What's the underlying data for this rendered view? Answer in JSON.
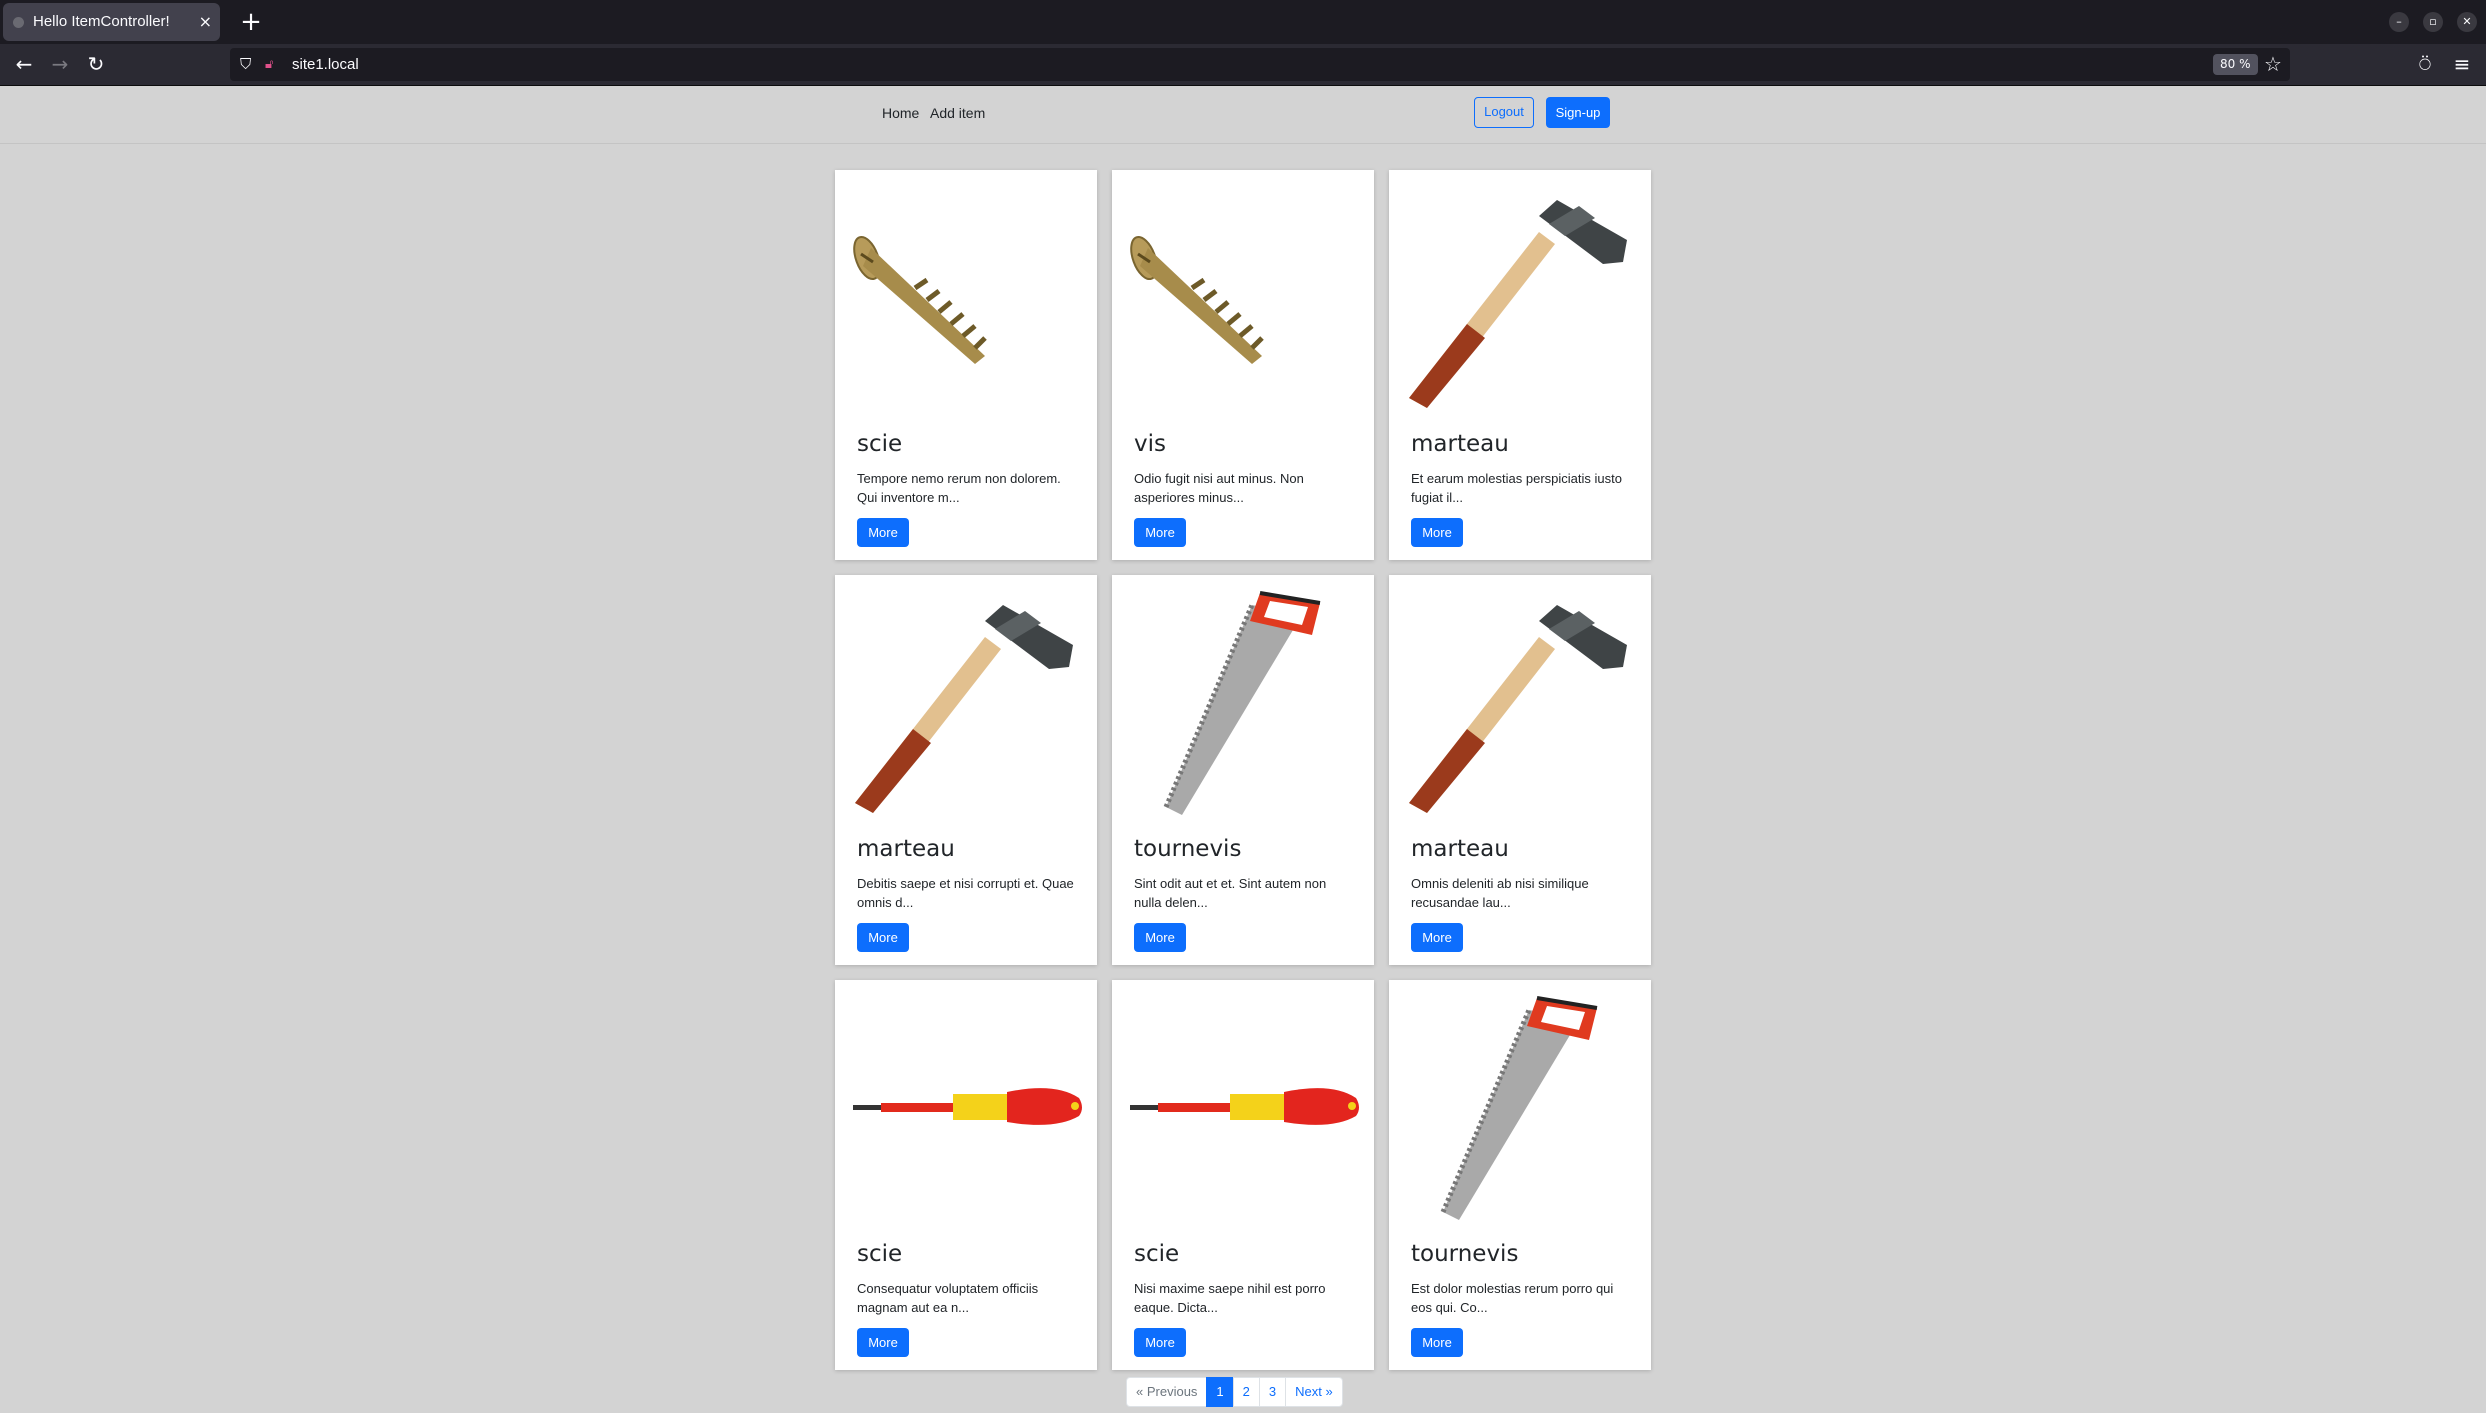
{
  "browser": {
    "tab_title": "Hello ItemController!",
    "tab_close": "×",
    "new_tab": "+",
    "url": "site1.local",
    "zoom": "80 %"
  },
  "site": {
    "nav": {
      "home": "Home",
      "add_item": "Add item"
    },
    "auth": {
      "logout": "Logout",
      "signup": "Sign-up"
    }
  },
  "items": [
    {
      "title": "scie",
      "text": "Tempore nemo rerum non dolorem. Qui inventore m...",
      "button": "More",
      "image": "screw"
    },
    {
      "title": "vis",
      "text": "Odio fugit nisi aut minus. Non asperiores minus...",
      "button": "More",
      "image": "screw"
    },
    {
      "title": "marteau",
      "text": "Et earum molestias perspiciatis iusto fugiat il...",
      "button": "More",
      "image": "hammer"
    },
    {
      "title": "marteau",
      "text": "Debitis saepe et nisi corrupti et. Quae omnis d...",
      "button": "More",
      "image": "hammer"
    },
    {
      "title": "tournevis",
      "text": "Sint odit aut et et. Sint autem non nulla delen...",
      "button": "More",
      "image": "saw"
    },
    {
      "title": "marteau",
      "text": "Omnis deleniti ab nisi similique recusandae lau...",
      "button": "More",
      "image": "hammer"
    },
    {
      "title": "scie",
      "text": "Consequatur voluptatem officiis magnam aut ea n...",
      "button": "More",
      "image": "screwdriver"
    },
    {
      "title": "scie",
      "text": "Nisi maxime saepe nihil est porro eaque. Dicta...",
      "button": "More",
      "image": "screwdriver"
    },
    {
      "title": "tournevis",
      "text": "Est dolor molestias rerum porro qui eos qui. Co...",
      "button": "More",
      "image": "saw"
    }
  ],
  "pagination": {
    "previous": "« Previous",
    "pages": [
      "1",
      "2",
      "3"
    ],
    "current": "1",
    "next": "Next »"
  }
}
